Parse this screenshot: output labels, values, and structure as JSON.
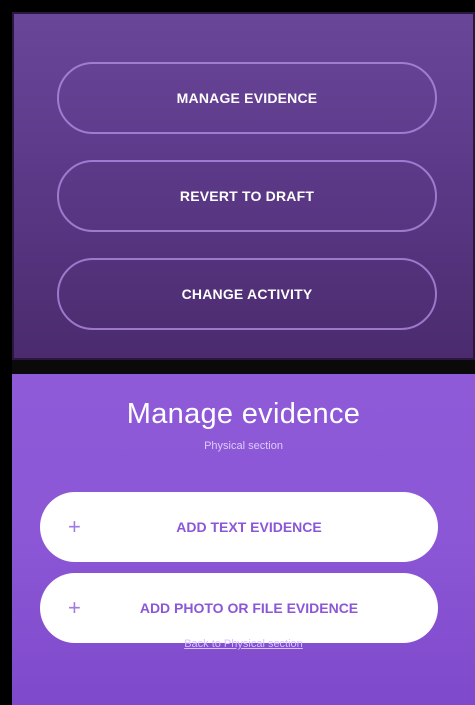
{
  "top_panel": {
    "buttons": [
      {
        "label": "MANAGE EVIDENCE"
      },
      {
        "label": "REVERT TO DRAFT"
      },
      {
        "label": "CHANGE ACTIVITY"
      }
    ]
  },
  "bottom_panel": {
    "title": "Manage evidence",
    "subtitle": "Physical section",
    "actions": [
      {
        "icon": "plus-icon",
        "label": "ADD TEXT EVIDENCE"
      },
      {
        "icon": "plus-icon",
        "label": "ADD PHOTO OR FILE EVIDENCE"
      }
    ],
    "back_link": "Back to Physical section"
  },
  "colors": {
    "top_panel_bg": "#5e3b8b",
    "bottom_panel_bg": "#8b57d6",
    "accent_text": "#8b57d6",
    "white": "#ffffff"
  }
}
